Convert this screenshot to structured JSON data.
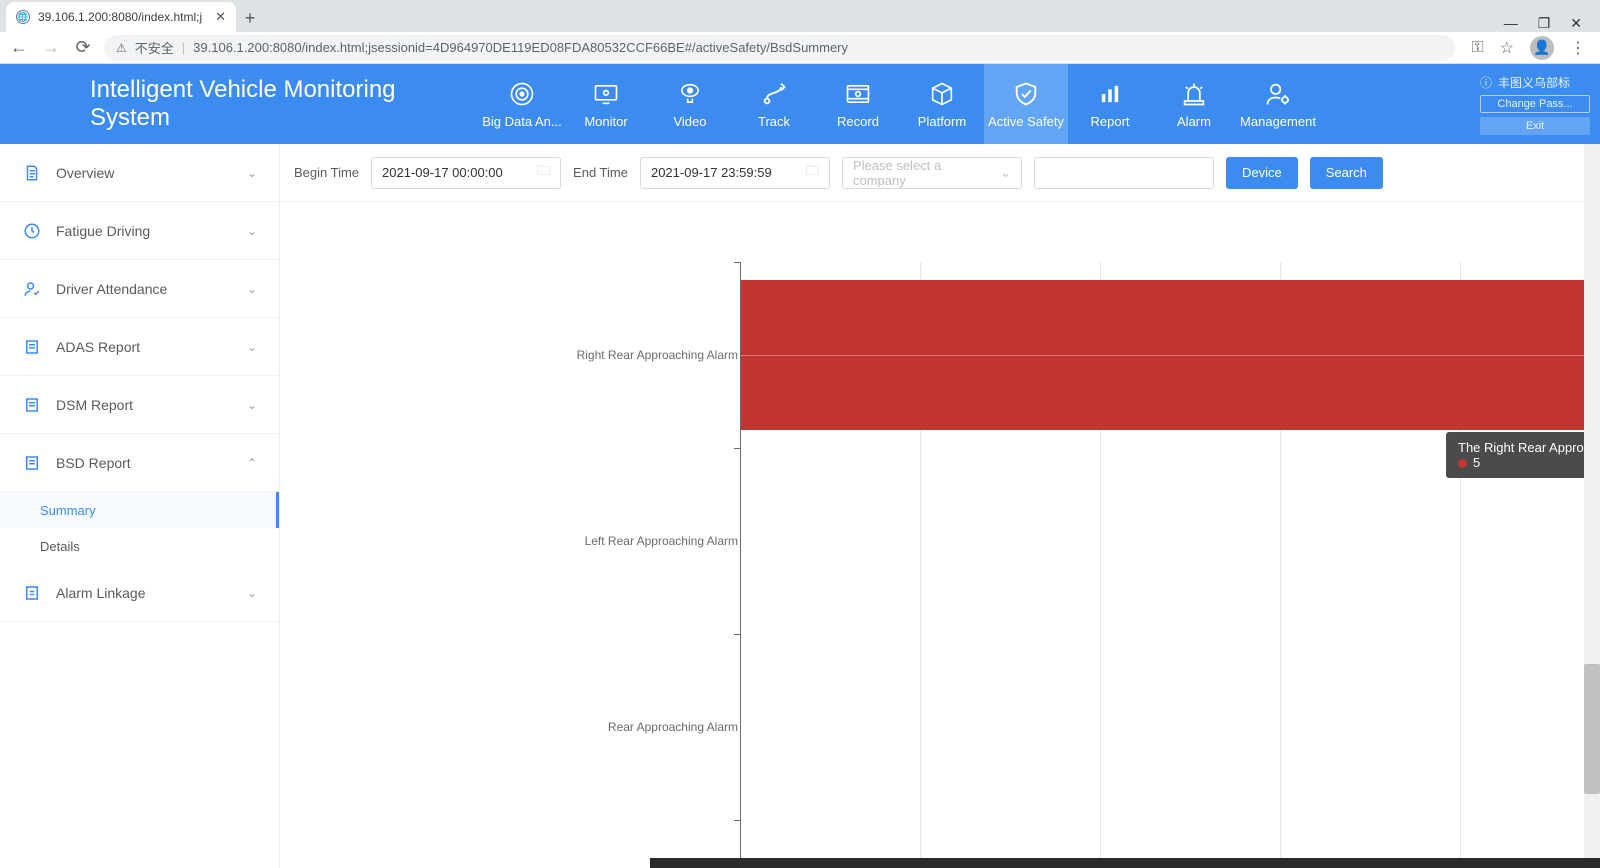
{
  "browser": {
    "tab_title": "39.106.1.200:8080/index.html;j",
    "insecure_label": "不安全",
    "url": "39.106.1.200:8080/index.html;jsessionid=4D964970DE119ED08FDA80532CCF66BE#/activeSafety/BsdSummery"
  },
  "header": {
    "brand": "Intelligent Vehicle Monitoring System",
    "nav": [
      {
        "label": "Big Data An..."
      },
      {
        "label": "Monitor"
      },
      {
        "label": "Video"
      },
      {
        "label": "Track"
      },
      {
        "label": "Record"
      },
      {
        "label": "Platform"
      },
      {
        "label": "Active Safety"
      },
      {
        "label": "Report"
      },
      {
        "label": "Alarm"
      },
      {
        "label": "Management"
      }
    ],
    "user": {
      "name": "丰图义乌部标",
      "change_pass": "Change Pass...",
      "exit": "Exit"
    }
  },
  "sidebar": {
    "items": [
      {
        "label": "Overview"
      },
      {
        "label": "Fatigue Driving"
      },
      {
        "label": "Driver Attendance"
      },
      {
        "label": "ADAS Report"
      },
      {
        "label": "DSM Report"
      },
      {
        "label": "BSD Report"
      },
      {
        "label": "Alarm Linkage"
      }
    ],
    "bsd_children": [
      {
        "label": "Summary"
      },
      {
        "label": "Details"
      }
    ]
  },
  "filters": {
    "begin_label": "Begin Time",
    "begin_value": "2021-09-17 00:00:00",
    "end_label": "End Time",
    "end_value": "2021-09-17 23:59:59",
    "company_placeholder": "Please select a company",
    "device_btn": "Device",
    "search_btn": "Search"
  },
  "tooltip": {
    "title": "The Right Rear Approaching Alarm",
    "value": "5"
  },
  "chart_data": {
    "type": "bar",
    "orientation": "horizontal",
    "categories": [
      "Right Rear Approaching Alarm",
      "Left Rear Approaching Alarm",
      "Rear Approaching Alarm"
    ],
    "values": [
      5,
      0,
      0
    ],
    "xlim": [
      0,
      5
    ],
    "series_name": "The Right Rear Approaching Alarm",
    "color": "#c23531"
  }
}
